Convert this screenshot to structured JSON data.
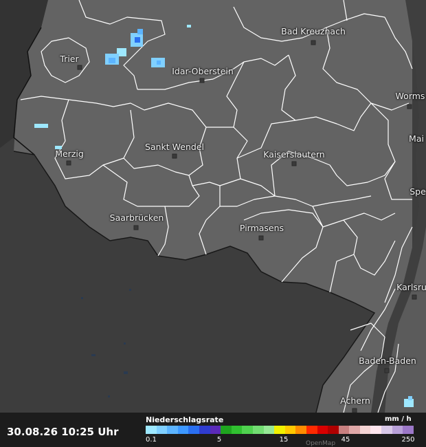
{
  "map": {
    "cities": [
      {
        "name": "Bad Kreuznach",
        "key": "bad-kreuznach"
      },
      {
        "name": "Trier",
        "key": "trier"
      },
      {
        "name": "Idar-Oberstein",
        "key": "idar-oberstein"
      },
      {
        "name": "Worms",
        "key": "worms"
      },
      {
        "name": "Mai",
        "key": "mainz"
      },
      {
        "name": "Sankt Wendel",
        "key": "sankt-wendel"
      },
      {
        "name": "Merzig",
        "key": "merzig"
      },
      {
        "name": "Kaiserslautern",
        "key": "kaiserslautern"
      },
      {
        "name": "Spe",
        "key": "speyer"
      },
      {
        "name": "Saarbrücken",
        "key": "saarbruecken"
      },
      {
        "name": "Pirmasens",
        "key": "pirmasens"
      },
      {
        "name": "Karlsru",
        "key": "karlsruhe"
      },
      {
        "name": "Baden-Baden",
        "key": "baden-baden"
      },
      {
        "name": "Achern",
        "key": "achern"
      }
    ],
    "colors": {
      "inland": "#636363",
      "outside": "#3d3d3d",
      "border": "#ffffff"
    }
  },
  "footer": {
    "timestamp": "30.08.26 10:25 Uhr",
    "legend_title": "Niederschlagsrate",
    "legend_unit": "mm / h",
    "legend_ticks": [
      "0.1",
      "5",
      "15",
      "45",
      "250"
    ],
    "attribution": "OpenMap"
  },
  "legend_colors": [
    "#9ee8ff",
    "#80d0ff",
    "#5cb4ff",
    "#3d98ff",
    "#2a6ff0",
    "#2f3cd0",
    "#5a2ab8",
    "#1fa51f",
    "#30c030",
    "#4fd24f",
    "#72dd72",
    "#96e896",
    "#f0f000",
    "#ffc800",
    "#ff8c00",
    "#ff2a00",
    "#d80000",
    "#b00000",
    "#c88080",
    "#e0a8a8",
    "#f4d4d4",
    "#ffe6ee",
    "#d8c8e8",
    "#b8a0d8",
    "#9c78c8"
  ]
}
